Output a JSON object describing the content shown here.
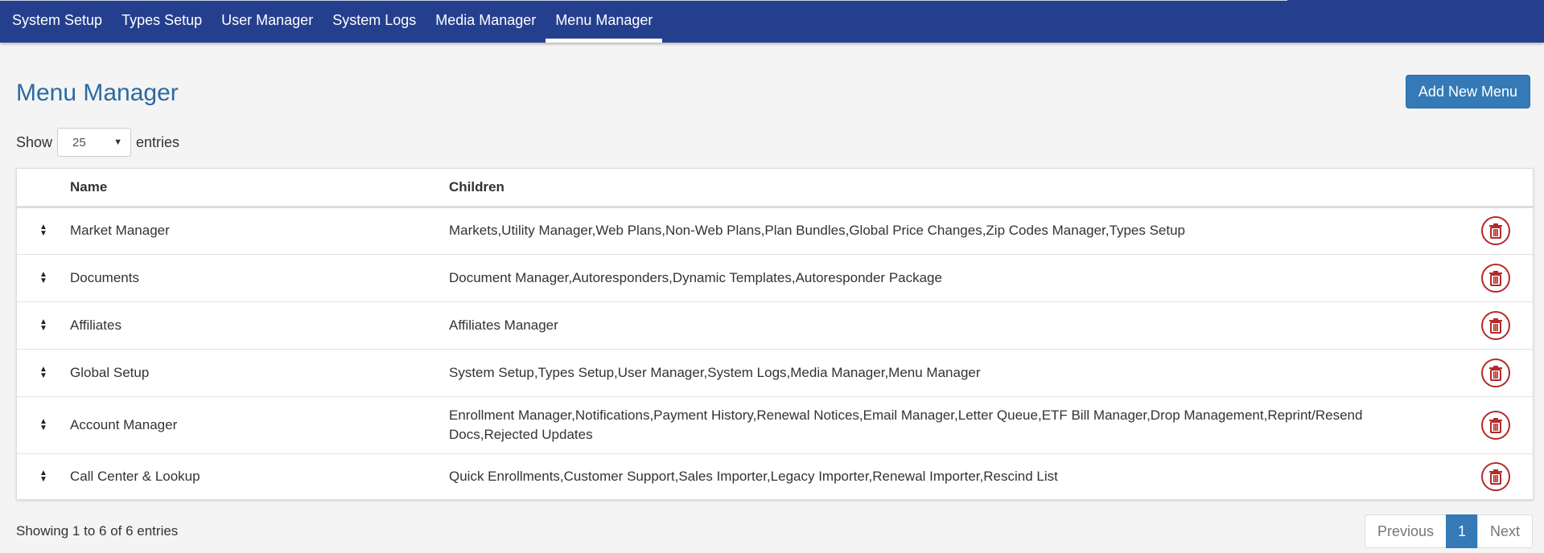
{
  "nav": {
    "items": [
      {
        "label": "System Setup"
      },
      {
        "label": "Types Setup"
      },
      {
        "label": "User Manager"
      },
      {
        "label": "System Logs"
      },
      {
        "label": "Media Manager"
      },
      {
        "label": "Menu Manager",
        "active": true
      }
    ]
  },
  "page": {
    "title": "Menu Manager",
    "add_button": "Add New Menu"
  },
  "length": {
    "show_label": "Show",
    "value": "25",
    "entries_label": "entries"
  },
  "table": {
    "headers": {
      "name": "Name",
      "children": "Children"
    },
    "rows": [
      {
        "name": "Market Manager",
        "children": "Markets,Utility Manager,Web Plans,Non-Web Plans,Plan Bundles,Global Price Changes,Zip Codes Manager,Types Setup"
      },
      {
        "name": "Documents",
        "children": "Document Manager,Autoresponders,Dynamic Templates,Autoresponder Package"
      },
      {
        "name": "Affiliates",
        "children": "Affiliates Manager"
      },
      {
        "name": "Global Setup",
        "children": "System Setup,Types Setup,User Manager,System Logs,Media Manager,Menu Manager"
      },
      {
        "name": "Account Manager",
        "children": "Enrollment Manager,Notifications,Payment History,Renewal Notices,Email Manager,Letter Queue,ETF Bill Manager,Drop Management,Reprint/Resend Docs,Rejected Updates"
      },
      {
        "name": "Call Center & Lookup",
        "children": "Quick Enrollments,Customer Support,Sales Importer,Legacy Importer,Renewal Importer,Rescind List"
      }
    ]
  },
  "footer": {
    "info": "Showing 1 to 6 of 6 entries",
    "previous": "Previous",
    "current_page": "1",
    "next": "Next"
  },
  "colors": {
    "nav_bg": "#253f8f",
    "title": "#2c6aa3",
    "primary": "#337ab7",
    "danger": "#b22a2a"
  },
  "icons": {
    "row_handle": "sort-handle-icon",
    "row_delete": "trash-icon",
    "select_caret": "caret-down-icon"
  }
}
